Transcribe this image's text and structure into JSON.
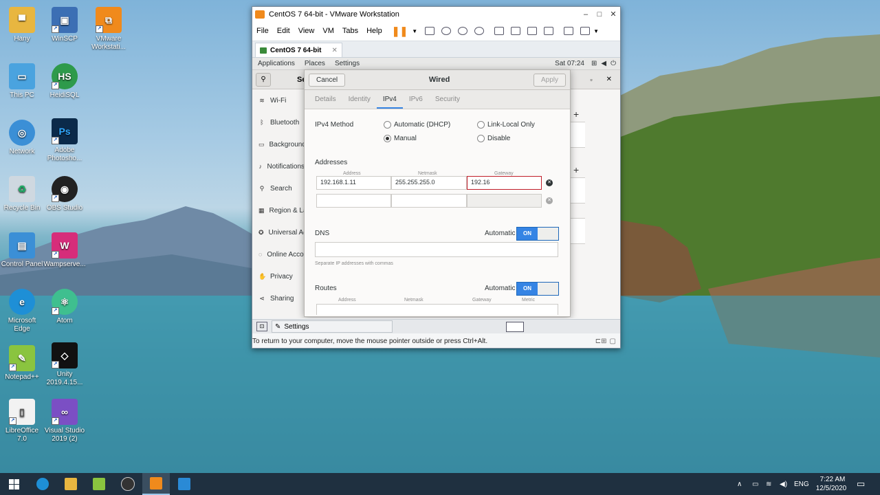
{
  "desktop": {
    "icons": [
      {
        "label": "Hany",
        "icon": "folder-user-icon",
        "color": "#e8b640"
      },
      {
        "label": "WinSCP",
        "icon": "winscp-icon",
        "color": "#3c6fb4"
      },
      {
        "label": "VMware Workstati...",
        "icon": "vmware-icon",
        "color": "#f08a1c"
      },
      {
        "label": "This PC",
        "icon": "computer-icon",
        "color": "#4aa3df"
      },
      {
        "label": "HeidiSQL",
        "icon": "heidisql-icon",
        "color": "#2e9a4b"
      },
      {
        "label": "Network",
        "icon": "network-icon",
        "color": "#3b8fd6"
      },
      {
        "label": "Adobe Photosho...",
        "icon": "photoshop-icon",
        "color": "#0b2a4a"
      },
      {
        "label": "Recycle Bin",
        "icon": "recycle-bin-icon",
        "color": "#cfd8e0"
      },
      {
        "label": "OBS Studio",
        "icon": "obs-icon",
        "color": "#222222"
      },
      {
        "label": "Control Panel",
        "icon": "control-panel-icon",
        "color": "#3b8fd6"
      },
      {
        "label": "Wampserve...",
        "icon": "wampserver-icon",
        "color": "#d62d7a"
      },
      {
        "label": "Microsoft Edge",
        "icon": "edge-icon",
        "color": "#1e8fd6"
      },
      {
        "label": "Atom",
        "icon": "atom-icon",
        "color": "#3fbf8f"
      },
      {
        "label": "Notepad++",
        "icon": "notepadpp-icon",
        "color": "#8ac43f"
      },
      {
        "label": "Unity 2019.4.15...",
        "icon": "unity-icon",
        "color": "#111111"
      },
      {
        "label": "LibreOffice 7.0",
        "icon": "libreoffice-icon",
        "color": "#f2f2f2"
      },
      {
        "label": "Visual Studio 2019 (2)",
        "icon": "visual-studio-icon",
        "color": "#7b4fc4"
      }
    ]
  },
  "vmware": {
    "title": "CentOS 7 64-bit - VMware Workstation",
    "menu": [
      "File",
      "Edit",
      "View",
      "VM",
      "Tabs",
      "Help"
    ],
    "tab_label": "CentOS 7 64-bit",
    "hint": "To return to your computer, move the mouse pointer outside or press Ctrl+Alt.",
    "status_app": "Settings"
  },
  "gnome": {
    "applications": "Applications",
    "places": "Places",
    "settings": "Settings",
    "clock": "Sat 07:24"
  },
  "settings_app": {
    "title_fragment": "Se",
    "sidebar": [
      {
        "label": "Wi-Fi",
        "icon": "wifi-icon"
      },
      {
        "label": "Bluetooth",
        "icon": "bluetooth-icon"
      },
      {
        "label": "Background",
        "icon": "background-icon"
      },
      {
        "label": "Notifications",
        "icon": "notifications-icon"
      },
      {
        "label": "Search",
        "icon": "search-icon"
      },
      {
        "label": "Region & Language",
        "icon": "region-icon"
      },
      {
        "label": "Universal Access",
        "icon": "universal-access-icon"
      },
      {
        "label": "Online Accounts",
        "icon": "online-accounts-icon"
      },
      {
        "label": "Privacy",
        "icon": "privacy-icon"
      },
      {
        "label": "Sharing",
        "icon": "sharing-icon"
      }
    ]
  },
  "dialog": {
    "cancel": "Cancel",
    "title": "Wired",
    "apply": "Apply",
    "tabs": [
      "Details",
      "Identity",
      "IPv4",
      "IPv6",
      "Security"
    ],
    "active_tab": "IPv4",
    "ipv4_method_label": "IPv4 Method",
    "methods": {
      "automatic": "Automatic (DHCP)",
      "link_local": "Link-Local Only",
      "manual": "Manual",
      "disable": "Disable"
    },
    "selected_method": "Manual",
    "addresses_label": "Addresses",
    "col_address": "Address",
    "col_netmask": "Netmask",
    "col_gateway": "Gateway",
    "row1": {
      "address": "192.168.1.11",
      "netmask": "255.255.255.0",
      "gateway": "192.16"
    },
    "dns_label": "DNS",
    "automatic_label": "Automatic",
    "on_label": "ON",
    "dns_hint": "Separate IP addresses with commas",
    "routes_label": "Routes",
    "col_metric": "Metric"
  },
  "taskbar": {
    "time": "7:22 AM",
    "date": "12/5/2020",
    "lang": "ENG"
  },
  "colors": {
    "accent": "#3584e4",
    "error": "#c01c28",
    "taskbar": "#1f3040"
  }
}
